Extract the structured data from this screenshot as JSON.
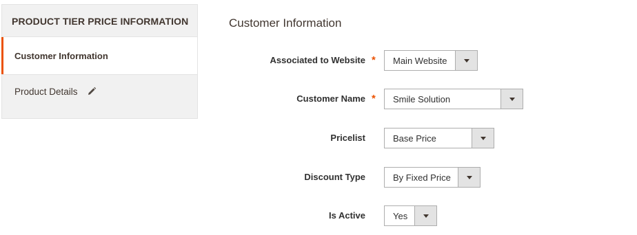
{
  "sidebar": {
    "title": "PRODUCT TIER PRICE INFORMATION",
    "items": [
      {
        "label": "Customer Information",
        "active": true
      },
      {
        "label": "Product Details",
        "active": false
      }
    ]
  },
  "main": {
    "section_title": "Customer Information",
    "fields": {
      "website": {
        "label": "Associated to Website",
        "required_mark": "*",
        "value": "Main Website"
      },
      "customer": {
        "label": "Customer Name",
        "required_mark": "*",
        "value": "Smile Solution"
      },
      "pricelist": {
        "label": "Pricelist",
        "value": "Base Price"
      },
      "discount": {
        "label": "Discount Type",
        "value": "By Fixed Price"
      },
      "active": {
        "label": "Is Active",
        "value": "Yes"
      }
    }
  },
  "colors": {
    "accent": "#eb5202",
    "sidebar_bg": "#f1f1f1",
    "border": "#adadad",
    "text": "#303030"
  }
}
